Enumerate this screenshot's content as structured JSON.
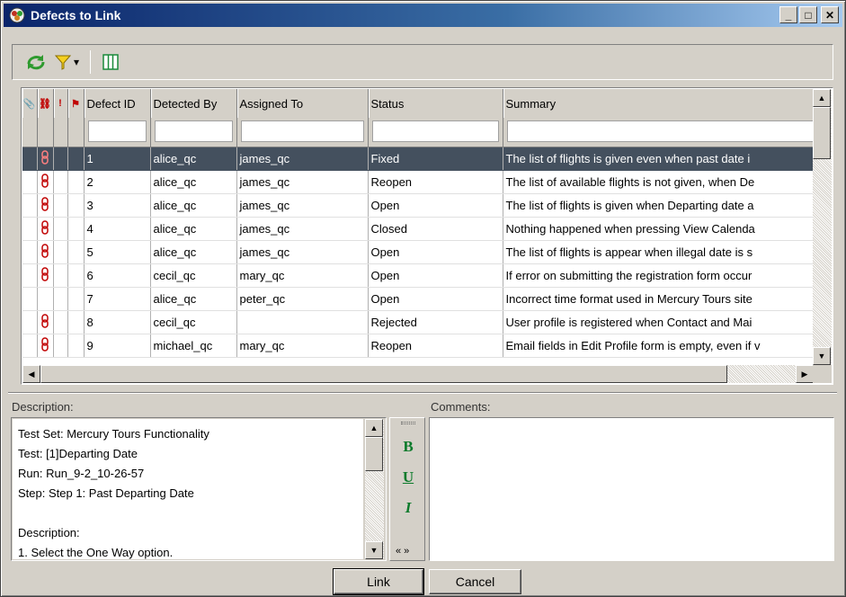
{
  "window": {
    "title": "Defects to Link"
  },
  "title_buttons": {
    "minimize": "_",
    "maximize": "□",
    "close": "✕"
  },
  "toolbar": {
    "icons": [
      "refresh-icon",
      "filter-icon",
      "dropdown-arrow-icon",
      "select-columns-icon"
    ],
    "filter_arrow": "▾"
  },
  "grid": {
    "columns": [
      {
        "key": "attachment",
        "label": "📎",
        "icon": "attachment-icon"
      },
      {
        "key": "linked",
        "label": "⛓",
        "icon": "link-icon"
      },
      {
        "key": "priority",
        "label": "!",
        "icon": "priority-icon"
      },
      {
        "key": "flag",
        "label": "⚑",
        "icon": "flag-icon"
      },
      {
        "key": "id",
        "label": "Defect ID"
      },
      {
        "key": "detected_by",
        "label": "Detected By"
      },
      {
        "key": "assigned_to",
        "label": "Assigned To"
      },
      {
        "key": "status",
        "label": "Status"
      },
      {
        "key": "summary",
        "label": "Summary"
      }
    ],
    "rows": [
      {
        "linked": true,
        "id": "1",
        "detected_by": "alice_qc",
        "assigned_to": "james_qc",
        "status": "Fixed",
        "summary": "The list of flights is given even when past date i",
        "selected": true
      },
      {
        "linked": true,
        "id": "2",
        "detected_by": "alice_qc",
        "assigned_to": "james_qc",
        "status": "Reopen",
        "summary": "The list of available flights is not given, when De"
      },
      {
        "linked": true,
        "id": "3",
        "detected_by": "alice_qc",
        "assigned_to": "james_qc",
        "status": "Open",
        "summary": "The list of flights is given when Departing date a"
      },
      {
        "linked": true,
        "id": "4",
        "detected_by": "alice_qc",
        "assigned_to": "james_qc",
        "status": "Closed",
        "summary": "Nothing happened when pressing View Calenda"
      },
      {
        "linked": true,
        "id": "5",
        "detected_by": "alice_qc",
        "assigned_to": "james_qc",
        "status": "Open",
        "summary": "The list of flights is appear when illegal date is s"
      },
      {
        "linked": true,
        "id": "6",
        "detected_by": "cecil_qc",
        "assigned_to": "mary_qc",
        "status": "Open",
        "summary": "If error on submitting the registration form occur"
      },
      {
        "linked": false,
        "id": "7",
        "detected_by": "alice_qc",
        "assigned_to": "peter_qc",
        "status": "Open",
        "summary": "Incorrect time format used in Mercury Tours site"
      },
      {
        "linked": true,
        "id": "8",
        "detected_by": "cecil_qc",
        "assigned_to": "",
        "status": "Rejected",
        "summary": "User profile is registered when Contact and Mai"
      },
      {
        "linked": true,
        "id": "9",
        "detected_by": "michael_qc",
        "assigned_to": "mary_qc",
        "status": "Reopen",
        "summary": "Email fields in Edit Profile form is empty, even if v"
      }
    ]
  },
  "description": {
    "label": "Description:",
    "lines": [
      "Test Set: Mercury Tours Functionality",
      "Test: [1]Departing Date",
      "Run: Run_9-2_10-26-57",
      "Step: Step 1: Past Departing Date",
      "",
      "Description:",
      "1. Select the One Way option."
    ]
  },
  "format_toolbar": {
    "bold": "B",
    "underline": "U",
    "italic": "I",
    "more": "« »"
  },
  "comments": {
    "label": "Comments:",
    "value": ""
  },
  "buttons": {
    "link": "Link",
    "cancel": "Cancel"
  },
  "colors": {
    "selected_row": "#44505e",
    "title_bar": "#0a246a",
    "link_icon": "#c00000",
    "format_icon": "#0a7a2a"
  }
}
